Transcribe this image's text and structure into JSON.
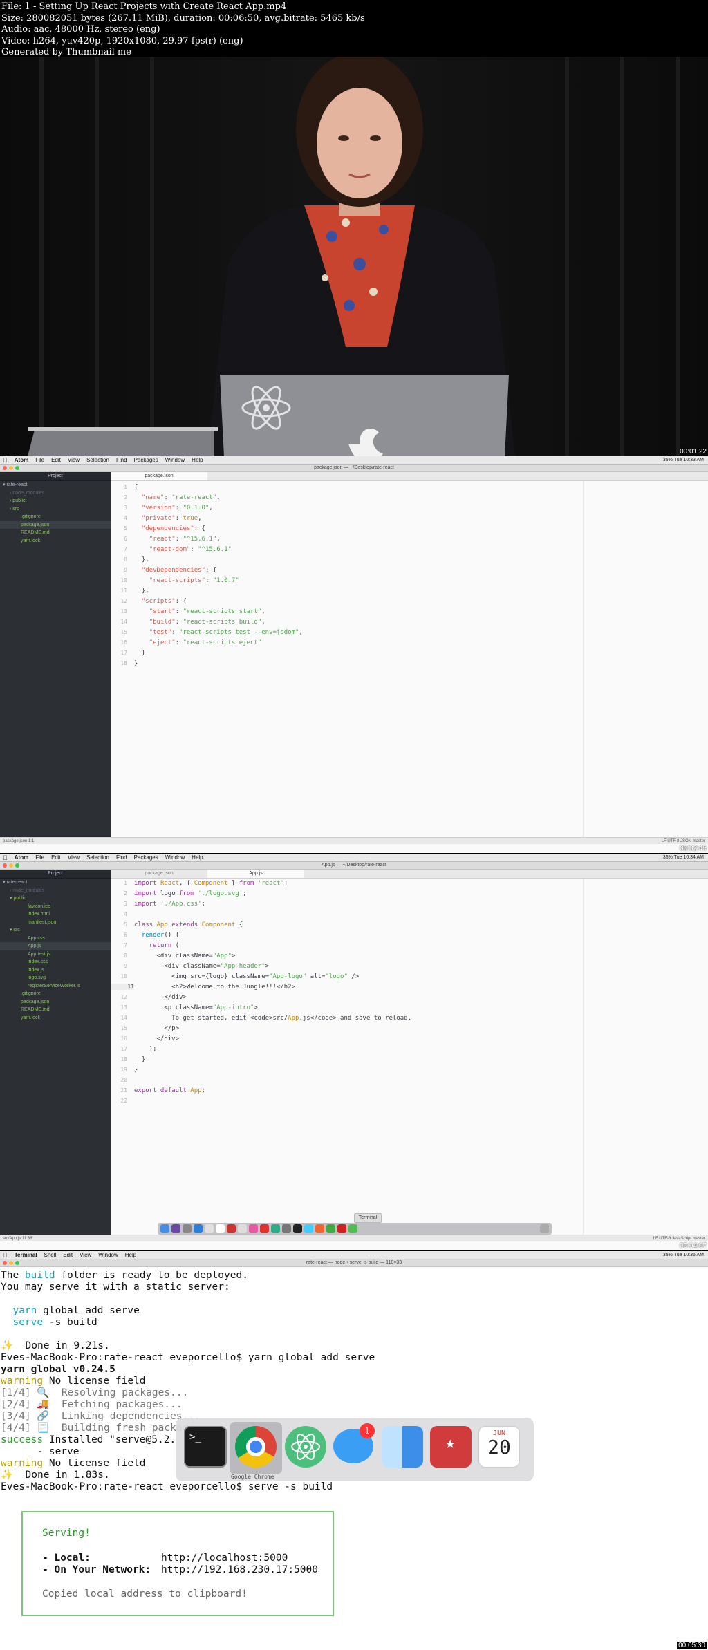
{
  "header": {
    "lines": [
      "File: 1 - Setting Up React Projects with Create React App.mp4",
      "Size: 280082051 bytes (267.11 MiB), duration: 00:06:50, avg.bitrate: 5465 kb/s",
      "Audio: aac, 48000 Hz, stereo (eng)",
      "Video: h264, yuv420p, 1920x1080, 29.97 fps(r) (eng)",
      "Generated by Thumbnail me"
    ]
  },
  "timestamps": [
    "00:01:22",
    "00:02:45",
    "00:04:07",
    "00:05:30"
  ],
  "menubar": {
    "app": "Atom",
    "items": [
      "File",
      "Edit",
      "View",
      "Selection",
      "Find",
      "Packages",
      "Window",
      "Help"
    ],
    "status1": "35%  Tue 10:33 AM",
    "status2": "35%  Tue 10:34 AM"
  },
  "editor1": {
    "window_title": "package.json — ~/Desktop/rate-react",
    "tab": "package.json",
    "tree_header": "Project",
    "tree": [
      "rate-react",
      "node_modules",
      "public",
      "src",
      ".gitignore",
      "package.json",
      "README.md",
      "yarn.lock"
    ],
    "status_left": "package.json  1:1",
    "status_right": "LF  UTF-8  JSON  master"
  },
  "editor2": {
    "window_title": "App.js — ~/Desktop/rate-react",
    "tabs": [
      "package.json",
      "App.js"
    ],
    "tree_header": "Project",
    "tree": [
      "rate-react",
      "node_modules",
      "public",
      "favicon.ico",
      "index.html",
      "manifest.json",
      "src",
      "App.css",
      "App.js",
      "App.test.js",
      "index.css",
      "index.js",
      "logo.svg",
      "registerServiceWorker.js",
      ".gitignore",
      "package.json",
      "README.md",
      "yarn.lock"
    ],
    "status_left": "src/App.js  11:36",
    "status_right": "LF  UTF-8  JavaScript  master",
    "terminal_tooltip": "Terminal"
  },
  "terminal": {
    "menubar_app": "Terminal",
    "menubar_items": [
      "Shell",
      "Edit",
      "View",
      "Window",
      "Help"
    ],
    "menubar_status": "35%  Tue 10:36 AM",
    "window_title": "rate-react — node • serve -s build — 118×33",
    "lines": [
      "The build folder is ready to be deployed.",
      "You may serve it with a static server:",
      "",
      "  yarn global add serve",
      "  serve -s build",
      "",
      "✨  Done in 9.21s.",
      "Eves-MacBook-Pro:rate-react eveporcello$ yarn global add serve",
      "yarn global v0.24.5",
      "warning No license field",
      "[1/4] 🔍  Resolving packages...",
      "[2/4] 🚚  Fetching packages...",
      "[3/4] 🔗  Linking dependencies...",
      "[4/4] 📃  Building fresh packag",
      "success Installed \"serve@5.2.",
      "      - serve",
      "warning No license field",
      "✨  Done in 1.83s.",
      "Eves-MacBook-Pro:rate-react eveporcello$ serve -s build"
    ],
    "serving": {
      "title": "Serving!",
      "local_label": "- Local:",
      "local_url": "http://localhost:5000",
      "network_label": "- On Your Network:",
      "network_url": "http://192.168.230.17:5000",
      "copied": "Copied local address to clipboard!"
    },
    "switcher_label": "Google Chrome",
    "calendar_month": "JUN",
    "calendar_day": "20",
    "messages_badge": "1"
  },
  "colors": {
    "atom_tree_bg": "#2c2f33",
    "editor_bg": "#fafafa",
    "serve_box_border": "#7cc77c"
  }
}
